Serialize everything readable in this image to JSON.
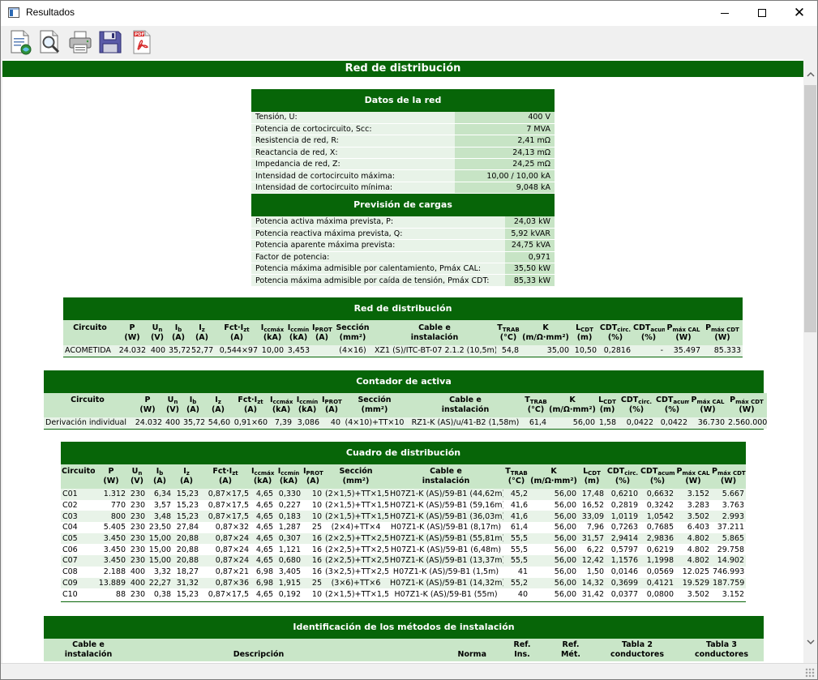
{
  "window": {
    "title": "Resultados",
    "minimize_glyph": "",
    "maximize_glyph": "",
    "close_glyph": "✕"
  },
  "toolbar": {
    "buttons": [
      {
        "name": "report-icon"
      },
      {
        "name": "preview-icon"
      },
      {
        "name": "printer-icon"
      },
      {
        "name": "save-disk-icon"
      },
      {
        "name": "pdf-icon",
        "label": "PDF"
      }
    ]
  },
  "colors": {
    "header_green": "#076508",
    "light_green": "#c9e6c8",
    "row_tint": "#e8f3e8"
  },
  "report": {
    "title": "Red de distribución",
    "datos": {
      "title": "Datos de la red",
      "rows": [
        {
          "label": "Tensión, U:",
          "value": "400 V"
        },
        {
          "label": "Potencia de cortocircuito, Scc:",
          "value": "7 MVA"
        },
        {
          "label": "Resistencia de red, R:",
          "value": "2,41 mΩ"
        },
        {
          "label": "Reactancia de red, X:",
          "value": "24,13 mΩ"
        },
        {
          "label": "Impedancia de red, Z:",
          "value": "24,25 mΩ"
        },
        {
          "label": "Intensidad de cortocircuito máxima:",
          "value": "10,00 / 10,00 kA"
        },
        {
          "label": "Intensidad de cortocircuito mínima:",
          "value": "9,048 kA"
        }
      ]
    },
    "prevision": {
      "title": "Previsión de cargas",
      "rows": [
        {
          "label": "Potencia activa máxima prevista, P:",
          "value": "24,03 kW"
        },
        {
          "label": "Potencia reactiva máxima prevista, Q:",
          "value": "5,92 kVAR"
        },
        {
          "label": "Potencia aparente máxima prevista:",
          "value": "24,75 kVA"
        },
        {
          "label": "Factor de potencia:",
          "value": "0,971"
        },
        {
          "label": "Potencia máxima admisible por calentamiento, Pmáx CAL:",
          "value": "35,50 kW"
        },
        {
          "label": "Potencia máxima admisible por caída de tensión, Pmáx CDT:",
          "value": "85,33 kW"
        }
      ]
    },
    "headers": {
      "circuito": "Circuito",
      "p": "P",
      "p_u": "(W)",
      "un": "U",
      "un_s": "n",
      "un_u": "(V)",
      "ib": "I",
      "ib_s": "b",
      "ib_u": "(A)",
      "iz": "I",
      "iz_s": "z",
      "iz_u": "(A)",
      "fct": "Fct·I",
      "fct_s": "zt",
      "fct_u": "(A)",
      "iccmax": "I",
      "iccmax_s": "ccmáx",
      "iccmax_u": "(kA)",
      "iccmin": "I",
      "iccmin_s": "ccmín",
      "iccmin_u": "(kA)",
      "iprot": "I",
      "iprot_s": "PROT",
      "iprot_u": "(A)",
      "seccion": "Sección",
      "seccion_u": "(mm²)",
      "cable": "Cable e",
      "cable_2": "instalación",
      "ttrab": "T",
      "ttrab_s": "TRAB",
      "ttrab_u": "(°C)",
      "k": "K",
      "k_u": "(m/Ω·mm²)",
      "lcdt": "L",
      "lcdt_s": "CDT",
      "lcdt_u": "(m)",
      "cdtc": "CDT",
      "cdtc_s": "circ.",
      "cdtc_u": "(%)",
      "cdta": "CDT",
      "cdta_s": "acum.",
      "cdta_u": "(%)",
      "pcal": "P",
      "pcal_s": "máx CAL",
      "pcal_u": "(W)",
      "pcdt": "P",
      "pcdt_s": "máx CDT",
      "pcdt_u": "(W)"
    },
    "red": {
      "title": "Red de distribución",
      "rows": [
        [
          "ACOMETIDA",
          "24.032",
          "400",
          "35,72",
          "52,77",
          "0,544×97",
          "10,00",
          "3,453",
          "",
          "(4×16)",
          "XZ1 (S)/ITC-BT-07 2.1.2 (10,5m)",
          "54,8",
          "35,00",
          "10,50",
          "0,2816",
          "-",
          "35.497",
          "85.333"
        ]
      ]
    },
    "contador": {
      "title": "Contador de activa",
      "rows": [
        [
          "Derivación individual",
          "24.032",
          "400",
          "35,72",
          "54,60",
          "0,91×60",
          "7,39",
          "3,086",
          "40",
          "(4×10)+TT×10",
          "RZ1-K (AS)/u/41-B2 (1,58m)",
          "61,4",
          "56,00",
          "1,58",
          "0,0422",
          "0,0422",
          "36.730",
          "2.560.000"
        ]
      ]
    },
    "cuadro": {
      "title": "Cuadro de distribución",
      "rows": [
        [
          "C01",
          "1.312",
          "230",
          "6,34",
          "15,23",
          "0,87×17,5",
          "4,65",
          "0,330",
          "10",
          "(2×1,5)+TT×1,5",
          "H07Z1-K (AS)/59-B1 (44,62m)",
          "45,2",
          "56,00",
          "17,48",
          "0,6210",
          "0,6632",
          "3.152",
          "5.667"
        ],
        [
          "C02",
          "770",
          "230",
          "3,57",
          "15,23",
          "0,87×17,5",
          "4,65",
          "0,227",
          "10",
          "(2×1,5)+TT×1,5",
          "H07Z1-K (AS)/59-B1 (59,16m)",
          "41,6",
          "56,00",
          "16,52",
          "0,2819",
          "0,3242",
          "3.283",
          "3.763"
        ],
        [
          "C03",
          "800",
          "230",
          "3,48",
          "15,23",
          "0,87×17,5",
          "4,65",
          "0,183",
          "10",
          "(2×1,5)+TT×1,5",
          "H07Z1-K (AS)/59-B1 (36,03m)",
          "41,6",
          "56,00",
          "33,09",
          "1,0119",
          "1,0542",
          "3.502",
          "2.993"
        ],
        [
          "C04",
          "5.405",
          "230",
          "23,50",
          "27,84",
          "0,87×32",
          "4,65",
          "1,287",
          "25",
          "(2×4)+TT×4",
          "H07Z1-K (AS)/59-B1 (8,17m)",
          "61,4",
          "56,00",
          "7,96",
          "0,7263",
          "0,7685",
          "6.403",
          "37.211"
        ],
        [
          "C05",
          "3.450",
          "230",
          "15,00",
          "20,88",
          "0,87×24",
          "4,65",
          "0,307",
          "16",
          "(2×2,5)+TT×2,5",
          "H07Z1-K (AS)/59-B1 (55,81m)",
          "55,5",
          "56,00",
          "31,57",
          "2,9414",
          "2,9836",
          "4.802",
          "5.865"
        ],
        [
          "C06",
          "3.450",
          "230",
          "15,00",
          "20,88",
          "0,87×24",
          "4,65",
          "1,121",
          "16",
          "(2×2,5)+TT×2,5",
          "H07Z1-K (AS)/59-B1 (6,48m)",
          "55,5",
          "56,00",
          "6,22",
          "0,5797",
          "0,6219",
          "4.802",
          "29.758"
        ],
        [
          "C07",
          "3.450",
          "230",
          "15,00",
          "20,88",
          "0,87×24",
          "4,65",
          "0,680",
          "16",
          "(2×2,5)+TT×2,5",
          "H07Z1-K (AS)/59-B1 (13,37m)",
          "55,5",
          "56,00",
          "12,42",
          "1,1576",
          "1,1998",
          "4.802",
          "14.902"
        ],
        [
          "C08",
          "2.188",
          "400",
          "3,32",
          "18,27",
          "0,87×21",
          "6,98",
          "3,405",
          "16",
          "(3×2,5)+TT×2,5",
          "H07Z1-K (AS)/59-B1 (1,5m)",
          "41",
          "56,00",
          "1,50",
          "0,0146",
          "0,0569",
          "12.025",
          "746.993"
        ],
        [
          "C09",
          "13.889",
          "400",
          "22,27",
          "31,32",
          "0,87×36",
          "6,98",
          "1,915",
          "25",
          "(3×6)+TT×6",
          "H07Z1-K (AS)/59-B1 (14,32m)",
          "55,2",
          "56,00",
          "14,32",
          "0,3699",
          "0,4121",
          "19.529",
          "187.759"
        ],
        [
          "C10",
          "88",
          "230",
          "0,38",
          "15,23",
          "0,87×17,5",
          "4,65",
          "0,192",
          "10",
          "(2×1,5)+TT×1,5",
          "H07Z1-K (AS)/59-B1 (55m)",
          "40",
          "56,00",
          "31,42",
          "0,0377",
          "0,0800",
          "3.502",
          "3.152"
        ]
      ]
    },
    "ident": {
      "title": "Identificación de los métodos de instalación",
      "cols": {
        "cable_1": "Cable e",
        "cable_2": "instalación",
        "desc": "Descripción",
        "norma": "Norma",
        "refins_1": "Ref.",
        "refins_2": "Ins.",
        "refmet_1": "Ref.",
        "refmet_2": "Mét.",
        "t2_1": "Tabla 2",
        "t2_2": "conductores",
        "t3_1": "Tabla 3",
        "t3_2": "conductores"
      }
    }
  }
}
